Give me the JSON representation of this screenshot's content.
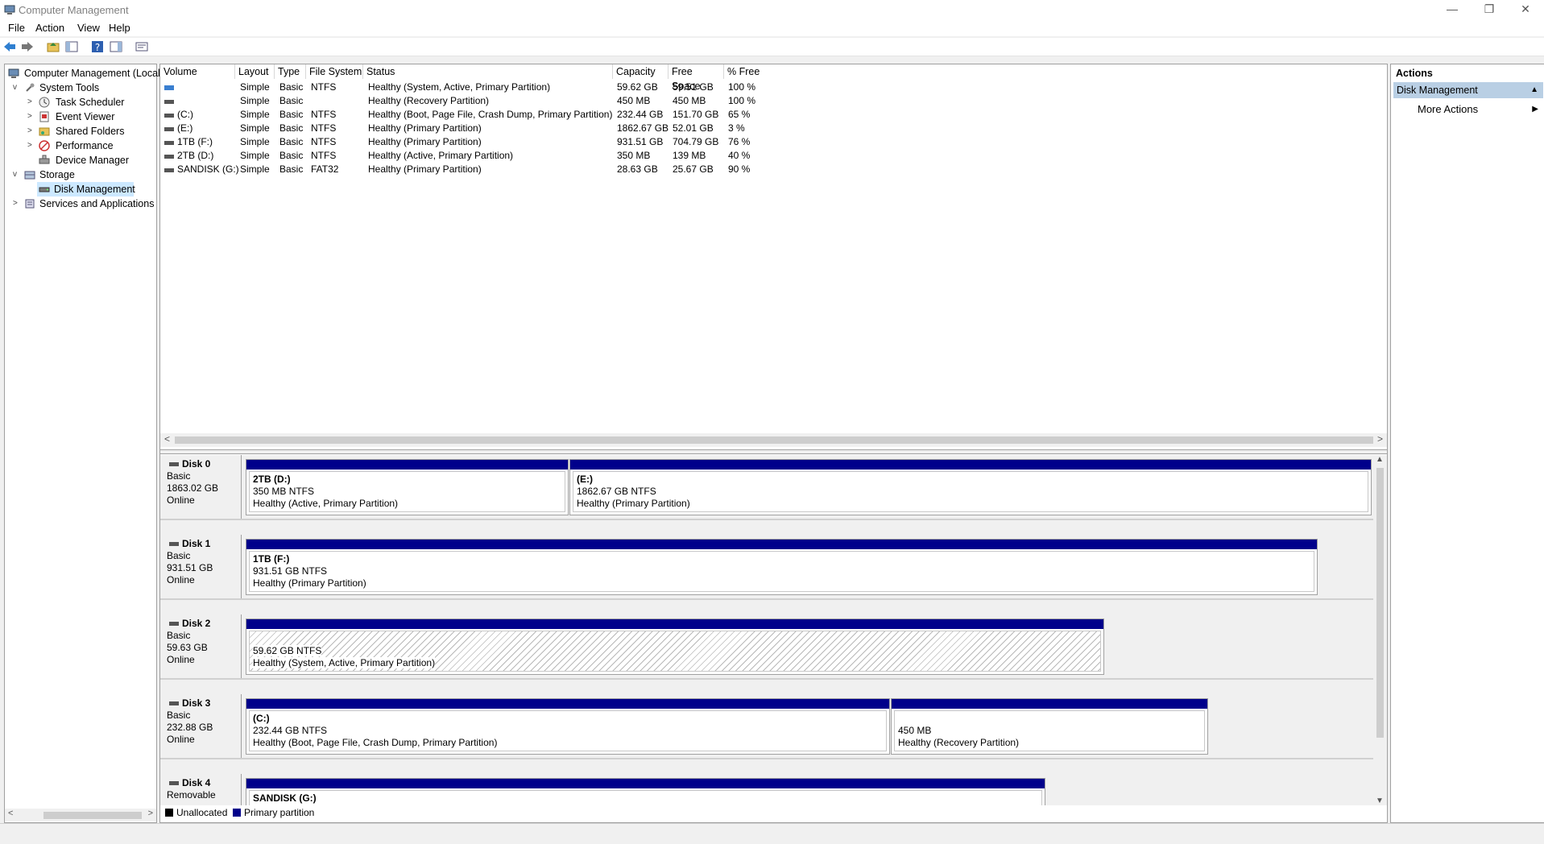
{
  "window": {
    "title": "Computer Management",
    "minimize": "—",
    "maximize": "❐",
    "close": "✕"
  },
  "menu": [
    "File",
    "Action",
    "View",
    "Help"
  ],
  "tree": [
    {
      "label": "Computer Management (Local",
      "level": 0,
      "expander": ""
    },
    {
      "label": "System Tools",
      "level": 1,
      "expander": "v"
    },
    {
      "label": "Task Scheduler",
      "level": 2,
      "expander": ">"
    },
    {
      "label": "Event Viewer",
      "level": 2,
      "expander": ">"
    },
    {
      "label": "Shared Folders",
      "level": 2,
      "expander": ">"
    },
    {
      "label": "Performance",
      "level": 2,
      "expander": ">"
    },
    {
      "label": "Device Manager",
      "level": 2,
      "expander": ""
    },
    {
      "label": "Storage",
      "level": 1,
      "expander": "v"
    },
    {
      "label": "Disk Management",
      "level": 2,
      "expander": "",
      "selected": true
    },
    {
      "label": "Services and Applications",
      "level": 1,
      "expander": ">"
    }
  ],
  "volume_table": {
    "headers": [
      "Volume",
      "Layout",
      "Type",
      "File System",
      "Status",
      "Capacity",
      "Free Space",
      "% Free"
    ],
    "rows": [
      [
        "",
        "Simple",
        "Basic",
        "NTFS",
        "Healthy (System, Active, Primary Partition)",
        "59.62 GB",
        "59.51 GB",
        "100 %"
      ],
      [
        "",
        "Simple",
        "Basic",
        "",
        "Healthy (Recovery Partition)",
        "450 MB",
        "450 MB",
        "100 %"
      ],
      [
        "(C:)",
        "Simple",
        "Basic",
        "NTFS",
        "Healthy (Boot, Page File, Crash Dump, Primary Partition)",
        "232.44 GB",
        "151.70 GB",
        "65 %"
      ],
      [
        "(E:)",
        "Simple",
        "Basic",
        "NTFS",
        "Healthy (Primary Partition)",
        "1862.67 GB",
        "52.01 GB",
        "3 %"
      ],
      [
        "1TB (F:)",
        "Simple",
        "Basic",
        "NTFS",
        "Healthy (Primary Partition)",
        "931.51 GB",
        "704.79 GB",
        "76 %"
      ],
      [
        "2TB (D:)",
        "Simple",
        "Basic",
        "NTFS",
        "Healthy (Active, Primary Partition)",
        "350 MB",
        "139 MB",
        "40 %"
      ],
      [
        "SANDISK (G:)",
        "Simple",
        "Basic",
        "FAT32",
        "Healthy (Primary Partition)",
        "28.63 GB",
        "25.67 GB",
        "90 %"
      ]
    ]
  },
  "disks": [
    {
      "name": "Disk 0",
      "type": "Basic",
      "size": "1863.02 GB",
      "status": "Online",
      "partitions": [
        {
          "title": "2TB  (D:)",
          "size": "350 MB NTFS",
          "status": "Healthy (Active, Primary Partition)"
        },
        {
          "title": " (E:)",
          "size": "1862.67 GB NTFS",
          "status": "Healthy (Primary Partition)"
        }
      ]
    },
    {
      "name": "Disk 1",
      "type": "Basic",
      "size": "931.51 GB",
      "status": "Online",
      "partitions": [
        {
          "title": "1TB  (F:)",
          "size": "931.51 GB NTFS",
          "status": "Healthy (Primary Partition)"
        }
      ]
    },
    {
      "name": "Disk 2",
      "type": "Basic",
      "size": "59.63 GB",
      "status": "Online",
      "partitions": [
        {
          "title": "",
          "size": "59.62 GB NTFS",
          "status": "Healthy (System, Active, Primary Partition)"
        }
      ]
    },
    {
      "name": "Disk 3",
      "type": "Basic",
      "size": "232.88 GB",
      "status": "Online",
      "partitions": [
        {
          "title": " (C:)",
          "size": "232.44 GB NTFS",
          "status": "Healthy (Boot, Page File, Crash Dump, Primary Partition)"
        },
        {
          "title": "",
          "size": "450 MB",
          "status": "Healthy (Recovery Partition)"
        }
      ]
    },
    {
      "name": "Disk 4",
      "type": "Removable",
      "size": "",
      "status": "",
      "partitions": [
        {
          "title": "SANDISK  (G:)",
          "size": "",
          "status": ""
        }
      ]
    }
  ],
  "legend": {
    "unallocated": "Unallocated",
    "primary": "Primary partition",
    "unallocated_color": "#000000",
    "primary_color": "#00008b"
  },
  "actions": {
    "title": "Actions",
    "section": "Disk Management",
    "item": "More Actions"
  }
}
